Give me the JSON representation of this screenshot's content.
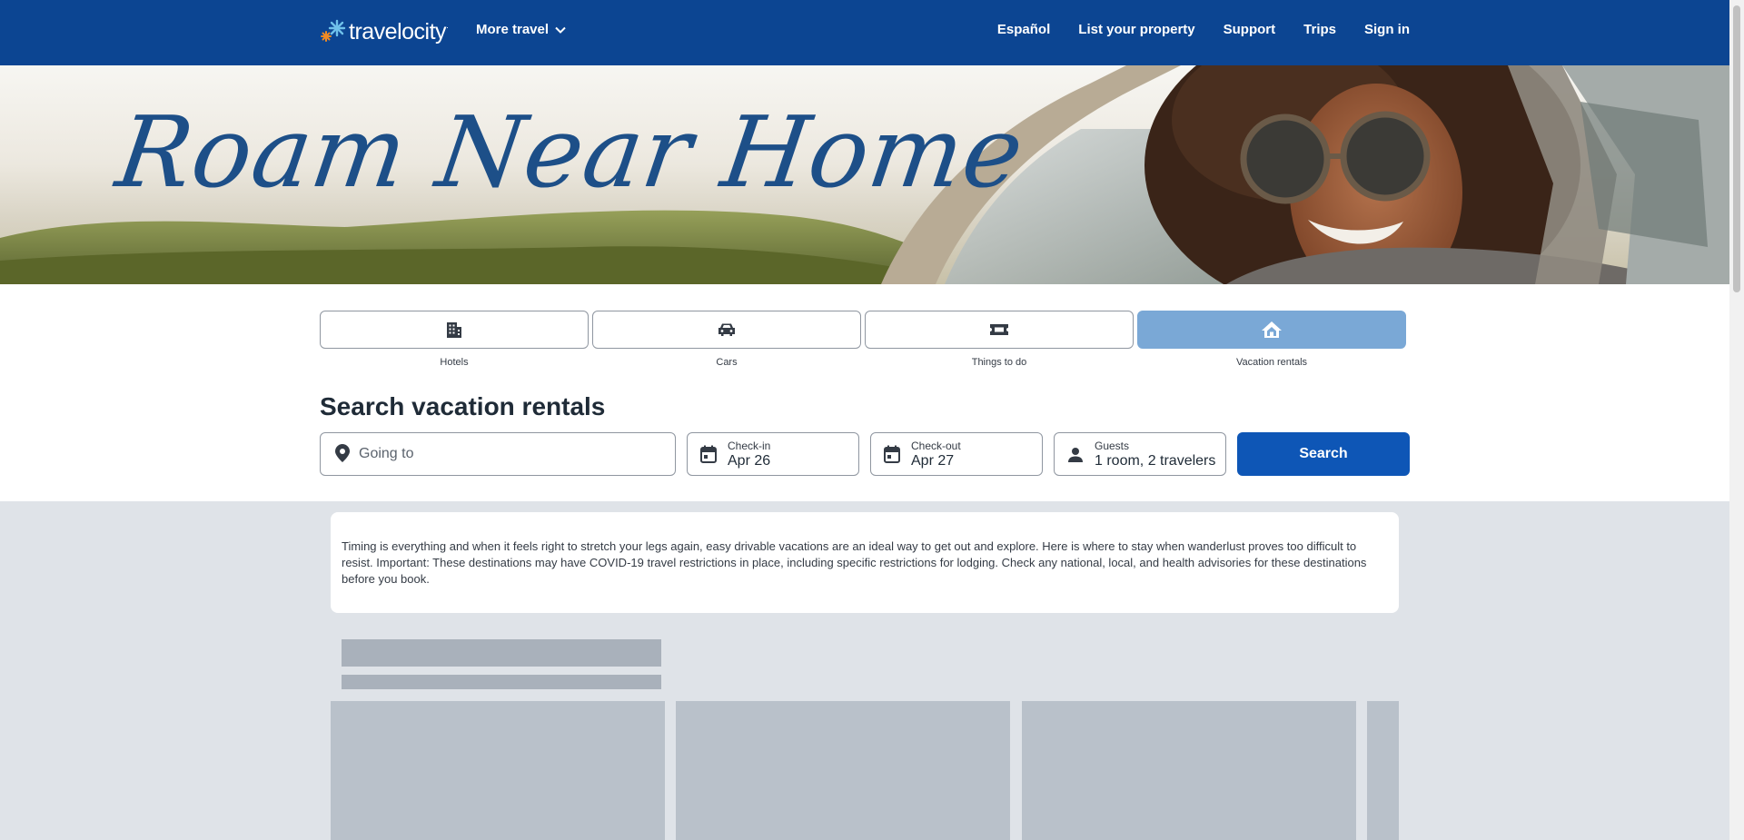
{
  "header": {
    "logo_text": "travelocity",
    "logo_mark": "·",
    "more_travel_label": "More travel",
    "nav": [
      {
        "label": "Español"
      },
      {
        "label": "List your property"
      },
      {
        "label": "Support"
      },
      {
        "label": "Trips"
      },
      {
        "label": "Sign in"
      }
    ]
  },
  "hero": {
    "title": "Roam Near Home"
  },
  "tabs": [
    {
      "label": "Hotels",
      "icon": "building-icon",
      "active": false
    },
    {
      "label": "Cars",
      "icon": "car-icon",
      "active": false
    },
    {
      "label": "Things to do",
      "icon": "ticket-icon",
      "active": false
    },
    {
      "label": "Vacation rentals",
      "icon": "house-icon",
      "active": true
    }
  ],
  "search": {
    "title": "Search vacation rentals",
    "going_to_placeholder": "Going to",
    "checkin_label": "Check-in",
    "checkin_value": "Apr 26",
    "checkout_label": "Check-out",
    "checkout_value": "Apr 27",
    "guests_label": "Guests",
    "guests_value": "1 room, 2 travelers",
    "button_label": "Search"
  },
  "intro": {
    "text": "Timing is everything and when it feels right to stretch your legs again, easy drivable vacations are an ideal way to get out and explore. Here is where to stay when wanderlust proves too difficult to resist. Important: These destinations may have COVID-19 travel restrictions in place, including specific restrictions for lodging. Check any national, local, and health advisories for these destinations before you book."
  },
  "colors": {
    "header_bg": "#0c4592",
    "accent": "#0e56b6",
    "active_tab": "#7aa8d6",
    "lower_bg": "#dfe3e8"
  }
}
